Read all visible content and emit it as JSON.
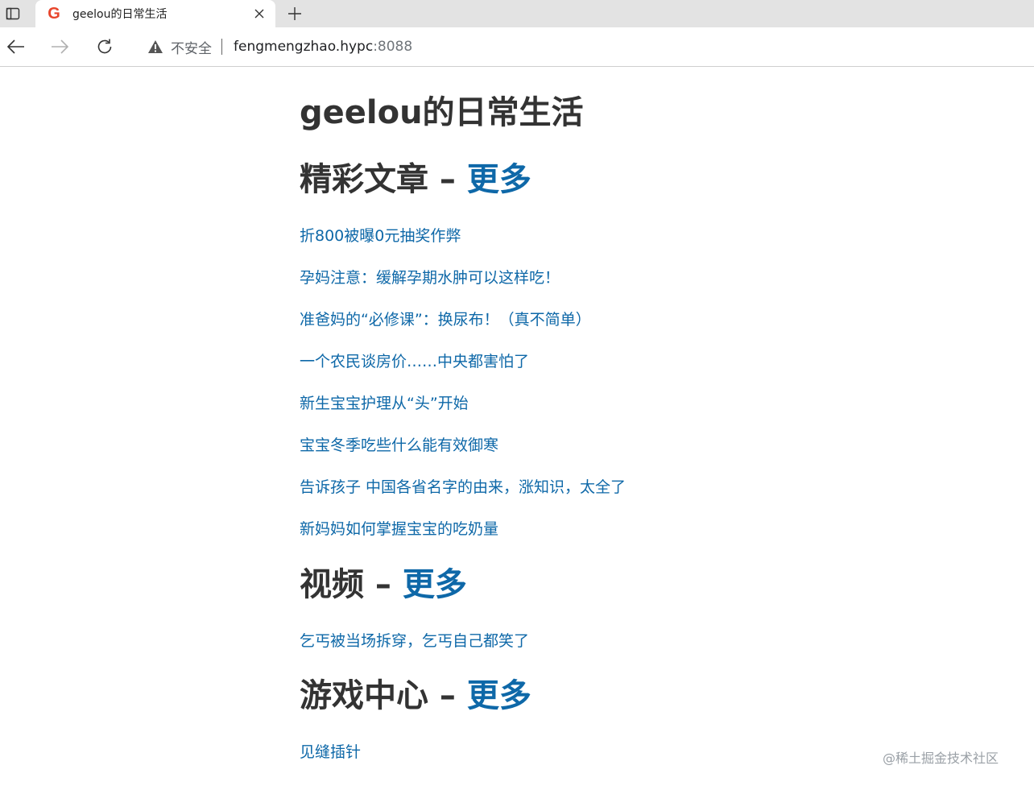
{
  "browser": {
    "tab": {
      "title": "geelou的日常生活",
      "favicon_letter": "G"
    },
    "security_text": "不安全",
    "url_host": "fengmengzhao.hypc",
    "url_port": ":8088",
    "icons": [
      "tab-actions-icon",
      "close-icon",
      "plus-icon",
      "back-arrow-icon",
      "forward-arrow-icon",
      "reload-icon",
      "warning-icon"
    ]
  },
  "page": {
    "title": "geelou的日常生活",
    "sections": [
      {
        "heading": "精彩文章 –",
        "more": "更多",
        "items": [
          "折800被曝0元抽奖作弊",
          "孕妈注意：缓解孕期水肿可以这样吃！",
          "准爸妈的“必修课”：换尿布！（真不简单）",
          "一个农民谈房价……中央都害怕了",
          "新生宝宝护理从“头”开始",
          "宝宝冬季吃些什么能有效御寒",
          "告诉孩子 中国各省名字的由来，涨知识，太全了",
          "新妈妈如何掌握宝宝的吃奶量"
        ]
      },
      {
        "heading": "视频 –",
        "more": "更多",
        "items": [
          "乞丐被当场拆穿，乞丐自己都笑了"
        ]
      },
      {
        "heading": "游戏中心 –",
        "more": "更多",
        "items": [
          "见缝插针"
        ]
      }
    ]
  },
  "watermark": "@稀土掘金技术社区",
  "colors": {
    "link": "#0e68a8",
    "heading": "#333333",
    "favicon": "#e8452c"
  }
}
